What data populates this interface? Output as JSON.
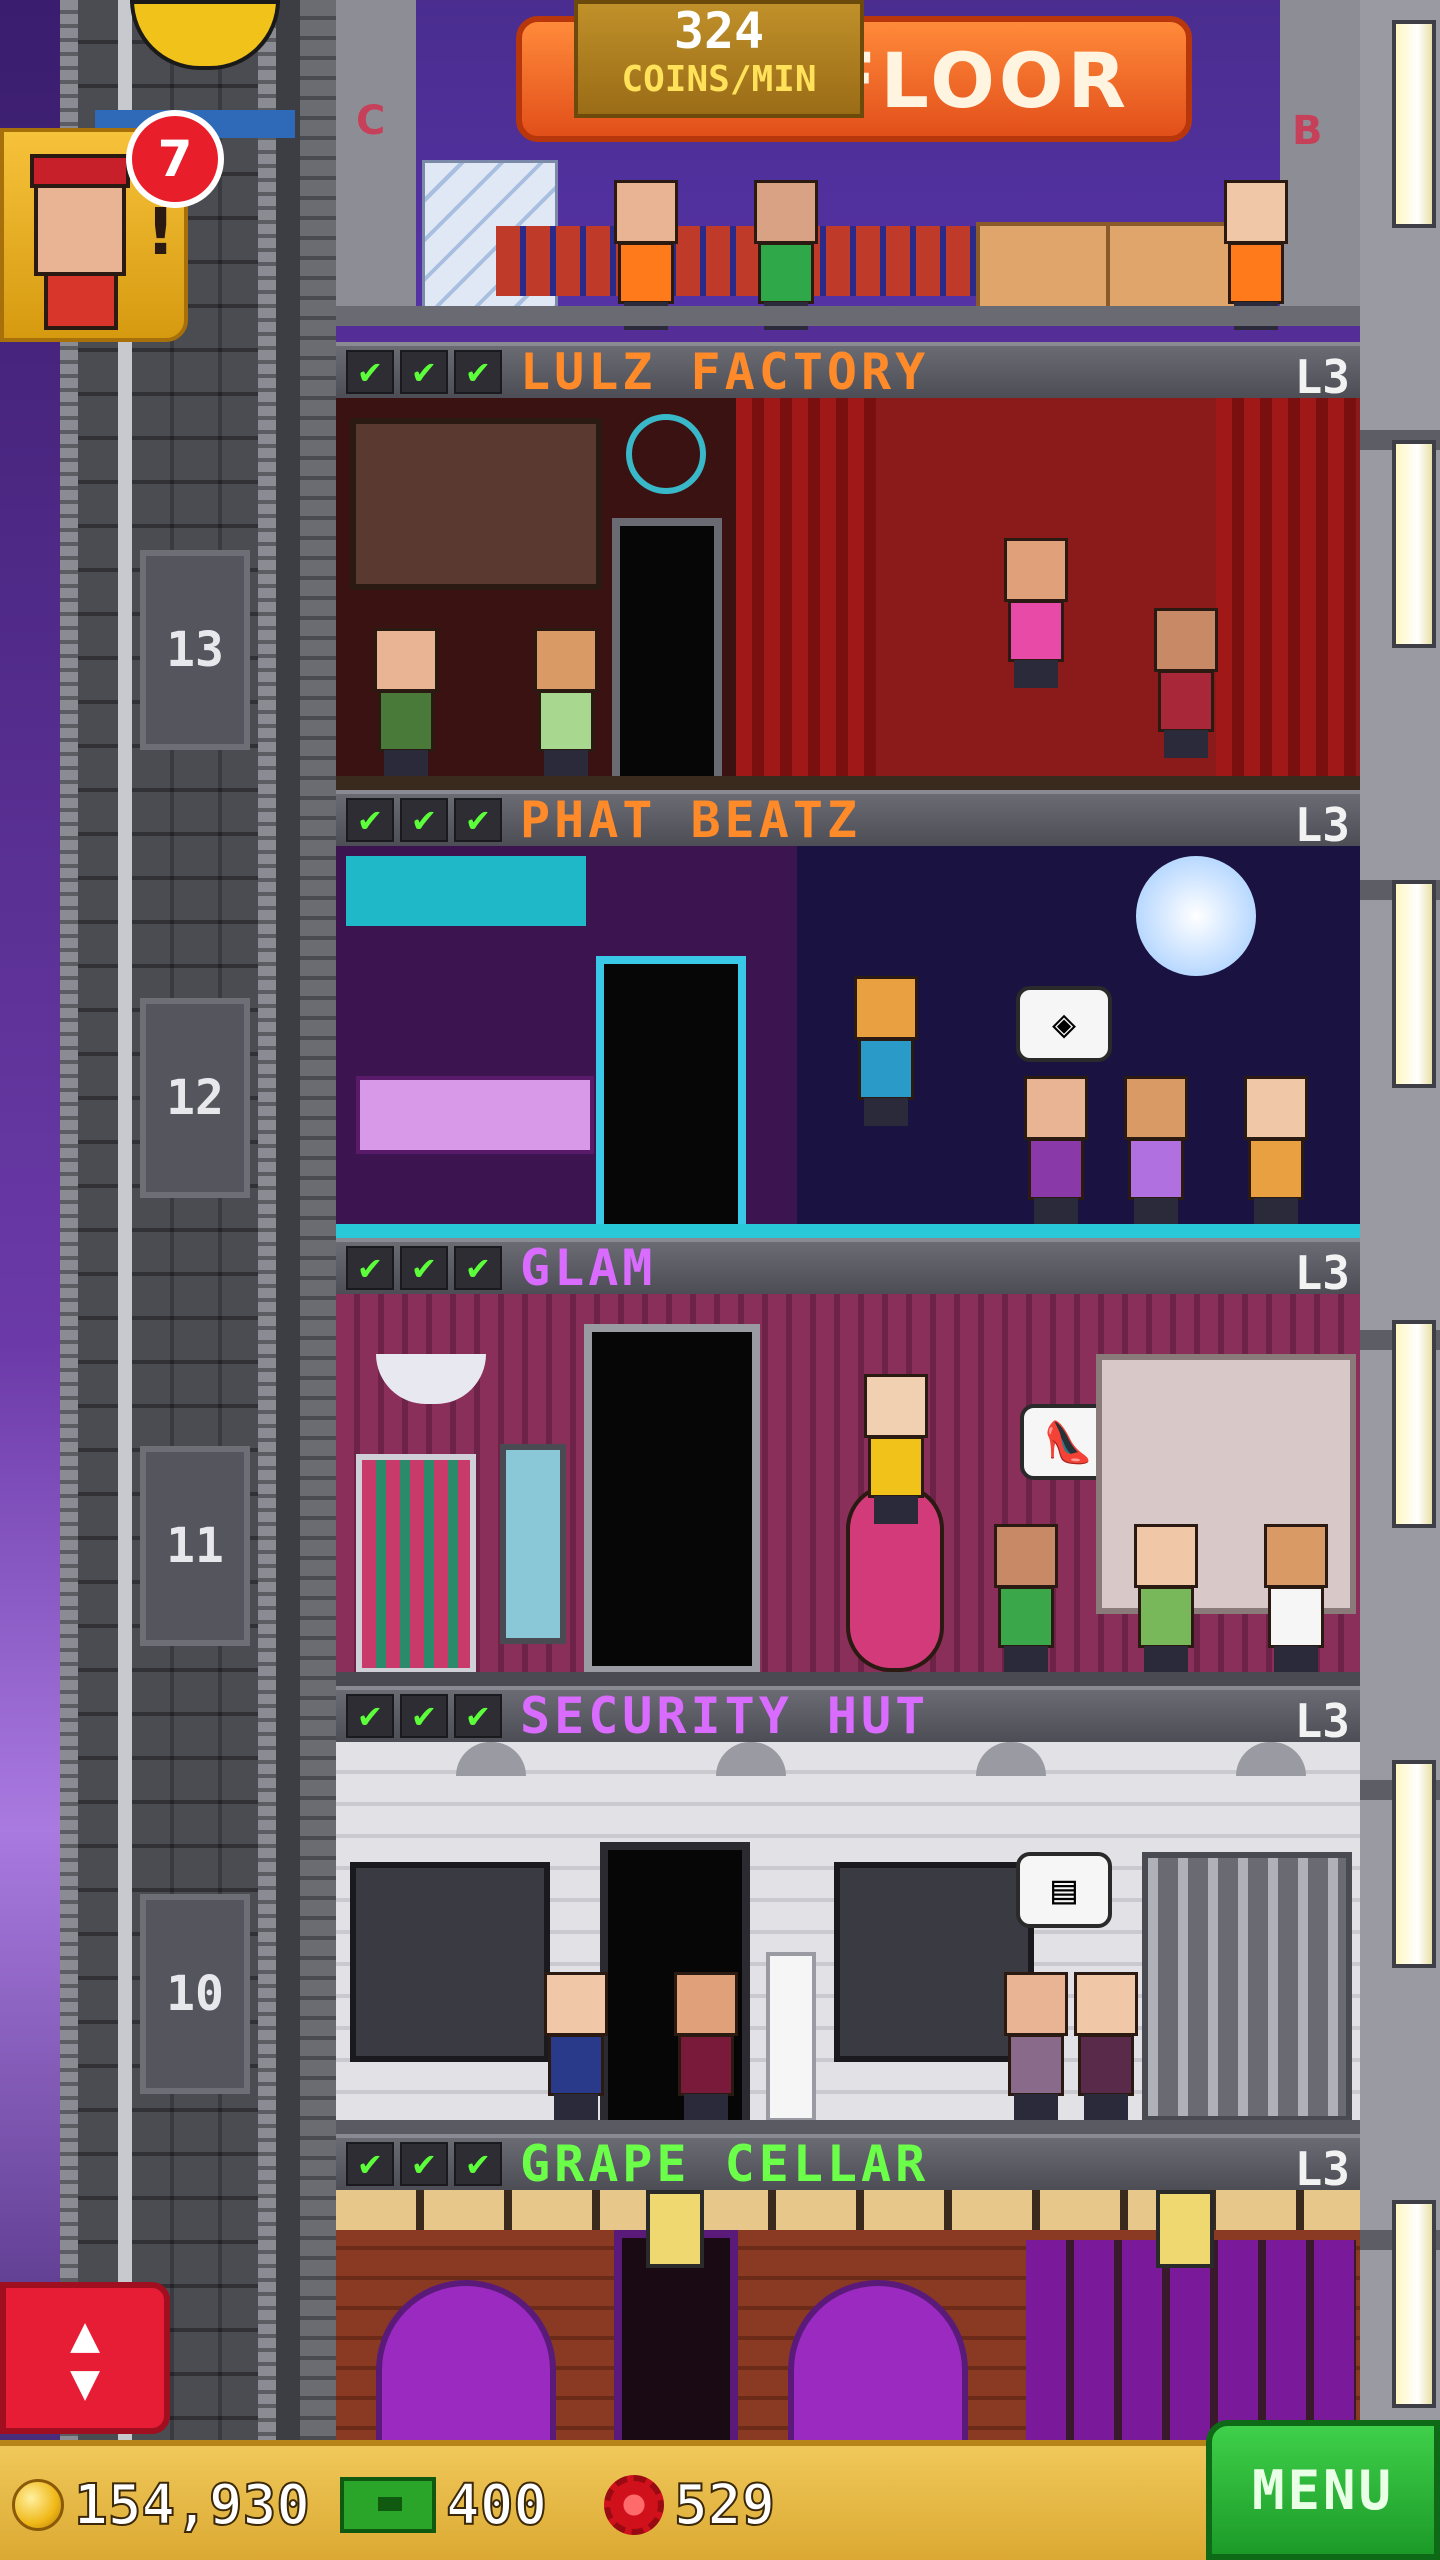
{
  "top_floor": {
    "coins_per_min_value": "324",
    "coins_per_min_label": "COINS/MIN",
    "banner_text": "FLOOR",
    "wall_letter_left": "C",
    "wall_letter_right": "B"
  },
  "notifications": {
    "bellhop_count": "7",
    "bellhop_alert": "!"
  },
  "elevator": {
    "up_arrow": "▲",
    "down_arrow": "▼",
    "floor_numbers": [
      "13",
      "12",
      "11",
      "10"
    ]
  },
  "floors": [
    {
      "checks": [
        "✔",
        "✔",
        "✔"
      ],
      "name": "LULZ FACTORY",
      "level": "L3",
      "name_color": "#ff8a2a"
    },
    {
      "checks": [
        "✔",
        "✔",
        "✔"
      ],
      "name": "PHAT BEATZ",
      "level": "L3",
      "name_color": "#ff8a2a"
    },
    {
      "checks": [
        "✔",
        "✔",
        "✔"
      ],
      "name": "GLAM",
      "level": "L3",
      "name_color": "#d96bff"
    },
    {
      "checks": [
        "✔",
        "✔",
        "✔"
      ],
      "name": "SECURITY HUT",
      "level": "L3",
      "name_color": "#d96bff"
    },
    {
      "checks": [
        "✔",
        "✔",
        "✔"
      ],
      "name": "GRAPE CELLAR",
      "level": "L3",
      "name_color": "#6bff4a"
    }
  ],
  "bubbles": {
    "phat_beatz": "◈",
    "glam": "👠",
    "security": "▤"
  },
  "bottom_bar": {
    "coins": "154,930",
    "bux": "400",
    "gems": "529",
    "menu_label": "MENU"
  },
  "icons": {
    "coin": "coin-icon",
    "bux": "bux-icon",
    "gear": "gear-icon",
    "checkmark": "checkmark-icon"
  },
  "colors": {
    "accent_green": "#1c9a28",
    "accent_red": "#e61d35",
    "bar_gold": "#f0c85a",
    "sky_purple": "#5a2a8c"
  }
}
